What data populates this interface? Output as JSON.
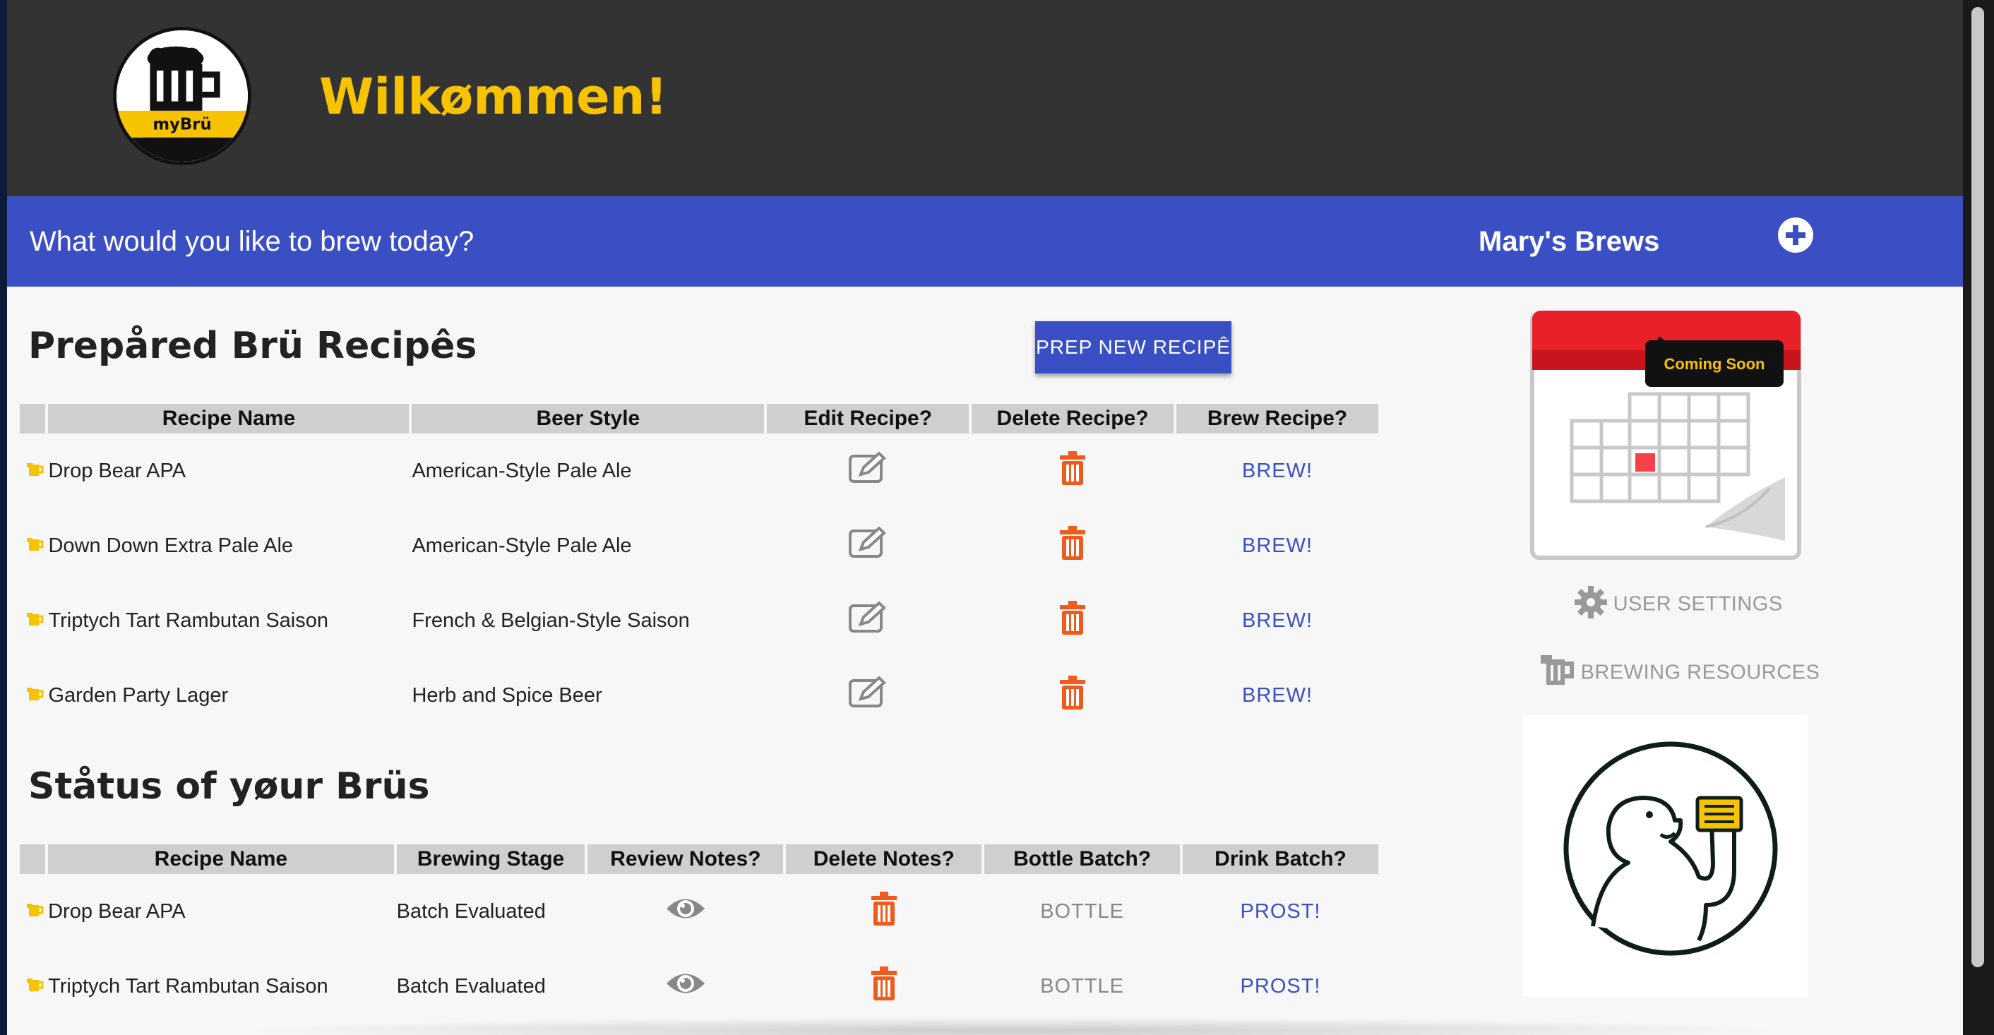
{
  "header": {
    "logo_text": "myBrü",
    "welcome": "Wilkømmen!"
  },
  "bluebar": {
    "prompt": "What would you like to brew today?",
    "brews_name": "Mary's Brews",
    "add_icon": "plus-circle-icon"
  },
  "recipes": {
    "title": "Prepåred Brü Recipês",
    "new_button": "PREP NEW RECIPÊ",
    "columns": [
      "Recipe Name",
      "Beer Style",
      "Edit Recipe?",
      "Delete Recipe?",
      "Brew Recipe?"
    ],
    "rows": [
      {
        "name": "Drop Bear APA",
        "style": "American-Style Pale Ale",
        "action": "BREW!"
      },
      {
        "name": "Down Down Extra Pale Ale",
        "style": "American-Style Pale Ale",
        "action": "BREW!"
      },
      {
        "name": "Triptych Tart Rambutan Saison",
        "style": "French & Belgian-Style Saison",
        "action": "BREW!"
      },
      {
        "name": "Garden Party Lager",
        "style": "Herb and Spice Beer",
        "action": "BREW!"
      }
    ]
  },
  "status": {
    "title": "Ståtus of yøur Brüs",
    "columns": [
      "Recipe Name",
      "Brewing Stage",
      "Review Notes?",
      "Delete Notes?",
      "Bottle Batch?",
      "Drink Batch?"
    ],
    "rows": [
      {
        "name": "Drop Bear APA",
        "stage": "Batch Evaluated",
        "bottle": "BOTTLE",
        "drink": "PROST!"
      },
      {
        "name": "Triptych Tart Rambutan Saison",
        "stage": "Batch Evaluated",
        "bottle": "BOTTLE",
        "drink": "PROST!"
      }
    ]
  },
  "sidebar": {
    "calendar_badge": "Coming Soon",
    "settings_label": "USER SETTINGS",
    "resources_label": "BREWING RESOURCES"
  },
  "colors": {
    "accent_blue": "#3b4fc4",
    "header_dark": "#333333",
    "welcome_yellow": "#f7c300",
    "delete_orange": "#f05a1a",
    "mug_yellow": "#f7c300"
  }
}
